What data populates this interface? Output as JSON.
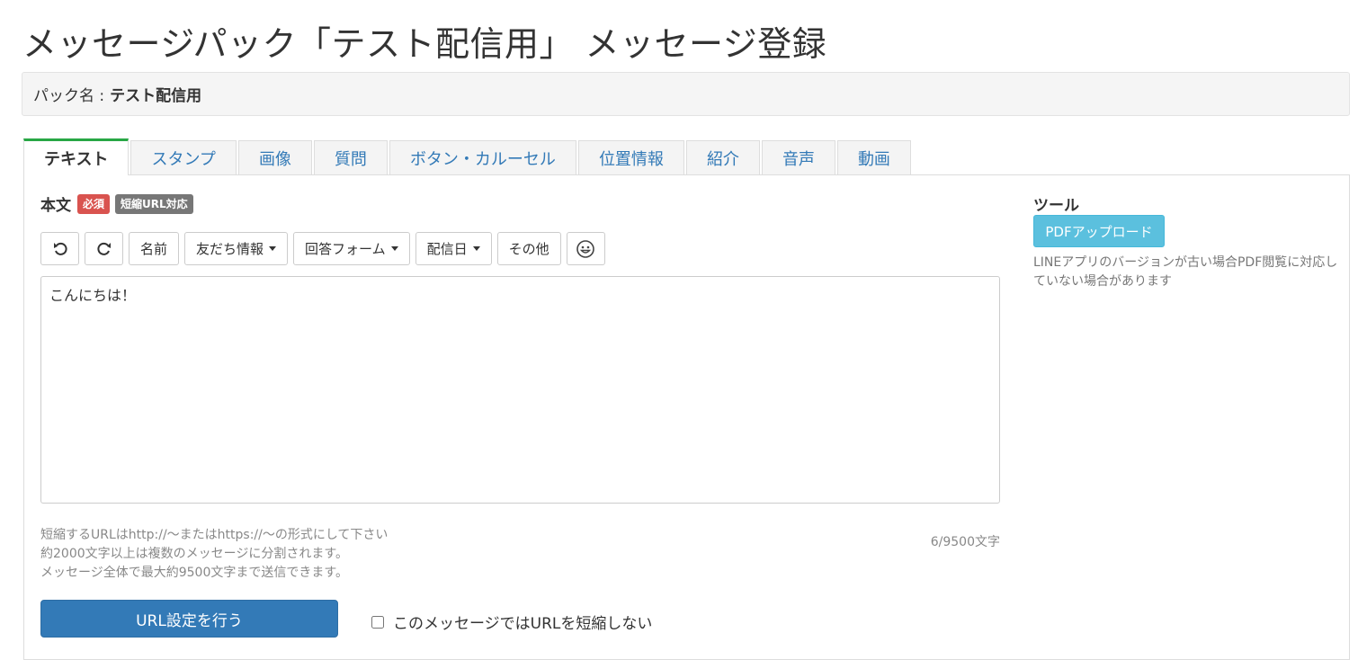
{
  "page": {
    "title": "メッセージパック「テスト配信用」 メッセージ登録"
  },
  "pack": {
    "label": "パック名 :",
    "name": "テスト配信用"
  },
  "tabs": [
    {
      "label": "テキスト",
      "active": true
    },
    {
      "label": "スタンプ"
    },
    {
      "label": "画像"
    },
    {
      "label": "質問"
    },
    {
      "label": "ボタン・カルーセル"
    },
    {
      "label": "位置情報"
    },
    {
      "label": "紹介"
    },
    {
      "label": "音声"
    },
    {
      "label": "動画"
    }
  ],
  "editor": {
    "label": "本文",
    "badge_required": "必須",
    "badge_short_url": "短縮URL対応",
    "toolbar": {
      "undo_icon": "undo-icon",
      "redo_icon": "redo-icon",
      "name": "名前",
      "friend_info": "友だち情報",
      "answer_form": "回答フォーム",
      "delivery_date": "配信日",
      "other": "その他",
      "emoji_icon": "smiley-icon"
    },
    "value": "こんにちは！",
    "help_lines": [
      "短縮するURLはhttp://～またはhttps://～の形式にして下さい",
      "約2000文字以上は複数のメッセージに分割されます。",
      "メッセージ全体で最大約9500文字まで送信できます。"
    ],
    "counter": "6/9500文字",
    "url_button": "URL設定を行う",
    "no_shorten_label": "このメッセージではURLを短縮しない",
    "no_shorten_checked": false
  },
  "tools": {
    "heading": "ツール",
    "pdf_button": "PDFアップロード",
    "note": "LINEアプリのバージョンが古い場合PDF閲覧に対応していない場合があります"
  },
  "colors": {
    "primary": "#337ab7",
    "info": "#5bc0de",
    "danger": "#d9534f",
    "muted_badge": "#777777",
    "active_tab_accent": "#28a745"
  }
}
